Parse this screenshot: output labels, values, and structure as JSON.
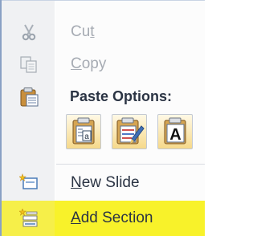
{
  "menu": {
    "items": {
      "cut": {
        "label_pre": "Cu",
        "label_ul": "t",
        "label_post": "",
        "icon": "scissors-icon",
        "enabled": false
      },
      "copy": {
        "label_pre": "",
        "label_ul": "C",
        "label_post": "opy",
        "icon": "copy-icon",
        "enabled": false
      },
      "paste_options": {
        "label": "Paste Options:",
        "icon": "clipboard-icon"
      },
      "new_slide": {
        "label_pre": "",
        "label_ul": "N",
        "label_post": "ew Slide",
        "icon": "new-slide-icon",
        "enabled": true
      },
      "add_section": {
        "label_pre": "",
        "label_ul": "A",
        "label_post": "dd Section",
        "icon": "add-section-icon",
        "enabled": true,
        "highlighted": true
      }
    },
    "paste_buttons": [
      {
        "name": "use-destination-theme",
        "glyph": "a"
      },
      {
        "name": "keep-source-formatting",
        "glyph": ""
      },
      {
        "name": "keep-text-only",
        "glyph": "A"
      }
    ],
    "colors": {
      "highlight": "#f8f22a",
      "disabled_text": "#a6abb3",
      "text": "#2b3444"
    }
  }
}
